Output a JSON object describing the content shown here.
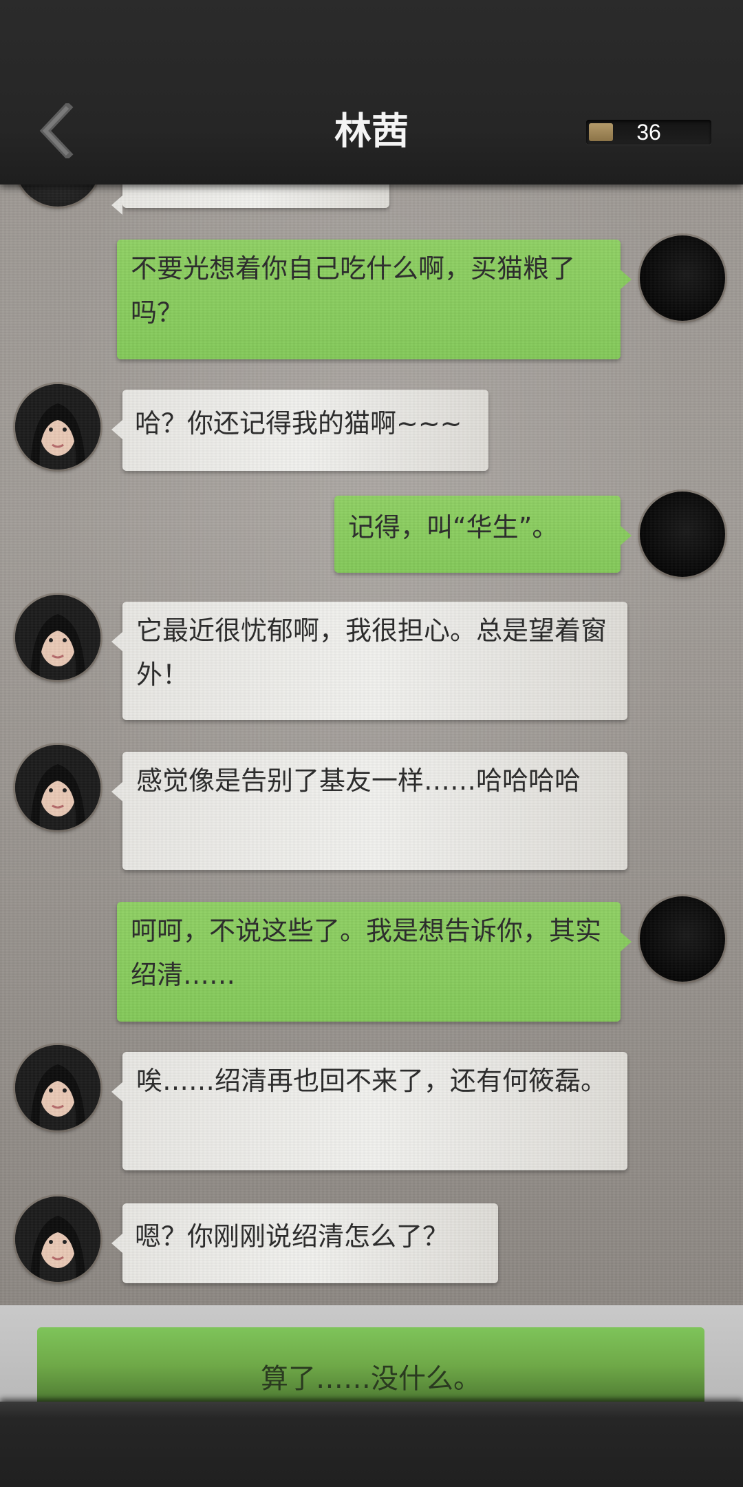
{
  "header": {
    "title": "林茜",
    "counter_value": "36",
    "counter_level": 0.2
  },
  "messages": [
    {
      "side": "out",
      "text": "不要光想着你自己吃什么啊，买猫粮了吗？"
    },
    {
      "side": "in",
      "text": "哈？你还记得我的猫啊~~~"
    },
    {
      "side": "out",
      "text": "记得，叫“华生”。"
    },
    {
      "side": "in",
      "text": "它最近很忧郁啊，我很担心。总是望着窗外！"
    },
    {
      "side": "in",
      "text": "感觉像是告别了基友一样……哈哈哈哈"
    },
    {
      "side": "out",
      "text": "呵呵，不说这些了。我是想告诉你，其实绍清……"
    },
    {
      "side": "in",
      "text": "唉……绍清再也回不来了，还有何筱磊。"
    },
    {
      "side": "in",
      "text": "嗯？你刚刚说绍清怎么了？"
    }
  ],
  "answer": {
    "label": "算了……没什么。"
  },
  "icons": {
    "back": "chevron-left-icon",
    "counter": "progress-bar"
  }
}
